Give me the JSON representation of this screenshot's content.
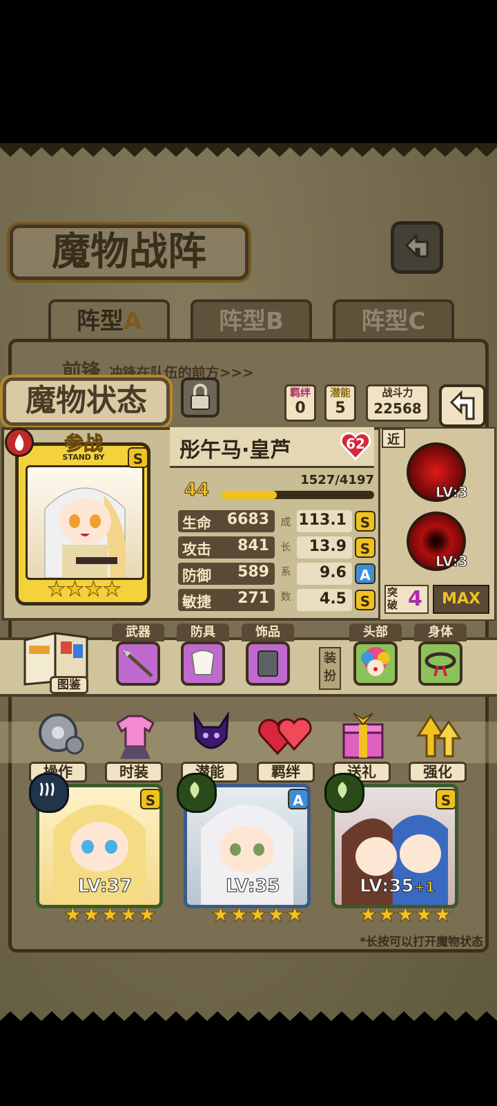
{
  "header": {
    "title": "魔物战阵"
  },
  "tabs": [
    {
      "label": "阵型",
      "letter": "A"
    },
    {
      "label": "阵型",
      "letter": "B"
    },
    {
      "label": "阵型",
      "letter": "C"
    }
  ],
  "row_hint": {
    "title": "前锋",
    "desc": "冲锋在队伍的前方>>>"
  },
  "panel": {
    "title": "魔物状态",
    "counters": [
      {
        "label": "羁绊",
        "value": "0"
      },
      {
        "label": "潜能",
        "value": "5"
      }
    ],
    "power_label": "战斗力",
    "power_value": "22568"
  },
  "monster": {
    "badge": "参战",
    "badge_sub": "STAND BY",
    "grade": "S",
    "name": "彤午马·皇芦",
    "heart": "62",
    "level": "44",
    "exp": "1527/4197",
    "exp_fraction": 0.364,
    "stats": [
      {
        "label": "生命",
        "value": "6683",
        "growth": "113.1",
        "grade": "S"
      },
      {
        "label": "攻击",
        "value": "841",
        "growth": "13.9",
        "grade": "S"
      },
      {
        "label": "防御",
        "value": "589",
        "growth": "9.6",
        "grade": "A"
      },
      {
        "label": "敏捷",
        "value": "271",
        "growth": "4.5",
        "grade": "S"
      }
    ],
    "growth_label": [
      "成",
      "长",
      "系",
      "数"
    ],
    "stars": 4
  },
  "skills": {
    "range_label": "近",
    "items": [
      {
        "level": "LV:3"
      },
      {
        "level": "LV:3"
      }
    ],
    "break_label": [
      "突",
      "破"
    ],
    "break_value": "4",
    "max_label": "MAX"
  },
  "equipment": {
    "book_label": "图鉴",
    "slots": [
      {
        "label": "武器"
      },
      {
        "label": "防具"
      },
      {
        "label": "饰品"
      }
    ],
    "dress_label": [
      "装",
      "扮"
    ],
    "costume": [
      {
        "label": "头部"
      },
      {
        "label": "身体"
      }
    ]
  },
  "menu": [
    {
      "label": "操作",
      "icon": "gear-icon"
    },
    {
      "label": "时装",
      "icon": "outfit-icon"
    },
    {
      "label": "潜能",
      "icon": "devil-icon"
    },
    {
      "label": "羁绊",
      "icon": "hearts-icon"
    },
    {
      "label": "送礼",
      "icon": "gift-icon"
    },
    {
      "label": "强化",
      "icon": "arrows-up-icon"
    }
  ],
  "team": [
    {
      "level": "LV:37",
      "extra": "",
      "grade": "S",
      "stars": 5
    },
    {
      "level": "LV:35",
      "extra": "",
      "grade": "A",
      "stars": 5
    },
    {
      "level": "LV:35",
      "extra": "+1",
      "grade": "S",
      "stars": 5
    }
  ],
  "footer_hint": "*长按可以打开魔物状态",
  "colors": {
    "gold": "#f0c21e",
    "dark_brown": "#4c3d29",
    "parchment": "#d8cca6",
    "heart_red": "#d8263a"
  }
}
